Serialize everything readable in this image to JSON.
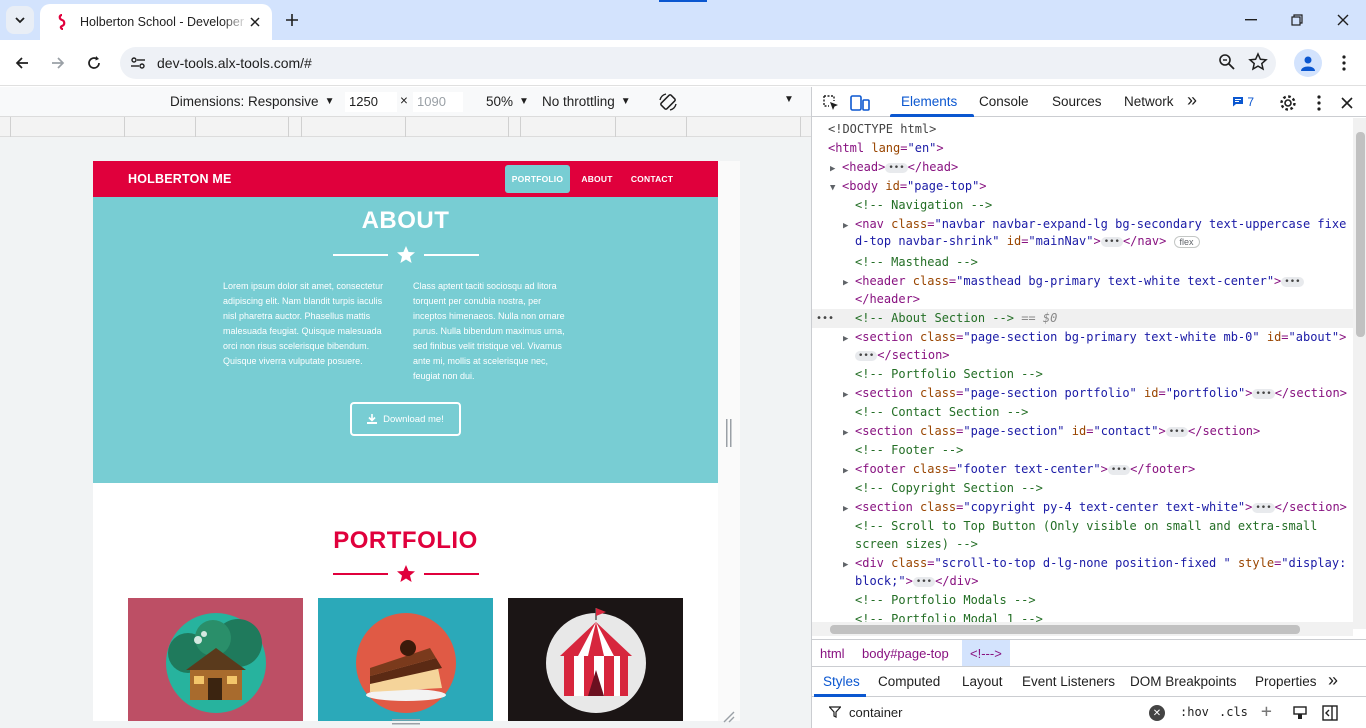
{
  "browser": {
    "tab_title": "Holberton School - Developer t",
    "url": "dev-tools.alx-tools.com/#"
  },
  "device_toolbar": {
    "dimensions_label": "Dimensions: Responsive",
    "width_value": "1250",
    "height_value": "1090",
    "times": "×",
    "zoom": "50%",
    "throttling": "No throttling"
  },
  "preview": {
    "brand": "HOLBERTON ME",
    "nav": [
      "PORTFOLIO",
      "ABOUT",
      "CONTACT"
    ],
    "about_title": "ABOUT",
    "about_col1": "Lorem ipsum dolor sit amet, consectetur adipiscing elit. Nam blandit turpis iaculis nisl pharetra auctor. Phasellus mattis malesuada feugiat. Quisque malesuada orci non risus scelerisque bibendum. Quisque viverra vulputate posuere.",
    "about_col2": "Class aptent taciti sociosqu ad litora torquent per conubia nostra, per inceptos himenaeos. Nulla non ornare purus. Nulla bibendum maximus urna, sed finibus velit tristique vel. Vivamus ante mi, mollis at scelerisque nec, feugiat non dui.",
    "download_label": "Download me!",
    "portfolio_title": "PORTFOLIO",
    "colors": {
      "primary": "#e0003c",
      "secondary": "#78cdd3"
    }
  },
  "devtools": {
    "tabs": [
      "Elements",
      "Console",
      "Sources",
      "Network"
    ],
    "more_tabs": "»",
    "issues_count": "7",
    "dom": {
      "l0": "<!DOCTYPE html>",
      "l1_tag": "<html ",
      "l1_attr": "lang",
      "l1_val": "\"en\"",
      "l1_end": ">",
      "l2_open": "<head>",
      "l2_close": "</head>",
      "l3_tag": "<body ",
      "l3_attr": "id",
      "l3_val": "\"page-top\"",
      "l3_end": ">",
      "l4": "<!-- Navigation -->",
      "l5_tag": "<nav ",
      "l5_attr1": "class",
      "l5_val1": "\"navbar navbar-expand-lg bg-secondary text-uppercase fixe",
      "l6_val1": "d-top navbar-shrink\"",
      "l6_attr2": "id",
      "l6_val2": "\"mainNav\"",
      "l6_close": "</nav>",
      "l6_badge": "flex",
      "l7": "<!-- Masthead -->",
      "l8_tag": "<header ",
      "l8_attr": "class",
      "l8_val": "\"masthead bg-primary text-white text-center\"",
      "l9_close": "</header>",
      "l10": "<!-- About Section -->",
      "l10_sel": "== $0",
      "l11_tag": "<section ",
      "l11_attr": "class",
      "l11_val": "\"page-section bg-primary text-white mb-0\"",
      "l11_attr2": "id",
      "l11_val2": "\"about\"",
      "l12_close": "</section>",
      "l13": "<!-- Portfolio Section -->",
      "l14_tag": "<section ",
      "l14_attr": "class",
      "l14_val": "\"page-section portfolio\"",
      "l14_attr2": "id",
      "l14_val2": "\"portfolio\"",
      "l14_close": "</section>",
      "l15": "<!-- Contact Section -->",
      "l16_tag": "<section ",
      "l16_attr": "class",
      "l16_val": "\"page-section\"",
      "l16_attr2": "id",
      "l16_val2": "\"contact\"",
      "l16_close": "</section>",
      "l17": "<!-- Footer -->",
      "l18_tag": "<footer ",
      "l18_attr": "class",
      "l18_val": "\"footer text-center\"",
      "l18_close": "</footer>",
      "l19": "<!-- Copyright Section -->",
      "l20_tag": "<section ",
      "l20_attr": "class",
      "l20_val": "\"copyright py-4 text-center text-white\"",
      "l20_close": "</section>",
      "l21": "<!-- Scroll to Top Button (Only visible on small and extra-small",
      "l22": "screen sizes) -->",
      "l23_tag": "<div ",
      "l23_attr": "class",
      "l23_val": "\"scroll-to-top d-lg-none position-fixed \"",
      "l23_attr2": "style",
      "l23_val2": "\"display:",
      "l24_val": "block;\"",
      "l24_close": "</div>",
      "l25": "<!-- Portfolio Modals -->",
      "l26": "<!-- Portfolio Modal 1 -->"
    },
    "breadcrumbs": [
      "html",
      "body#page-top",
      "<!--->"
    ],
    "styles_tabs": [
      "Styles",
      "Computed",
      "Layout",
      "Event Listeners",
      "DOM Breakpoints",
      "Properties"
    ],
    "filter_value": "container",
    "hov": ":hov",
    "cls": ".cls"
  }
}
